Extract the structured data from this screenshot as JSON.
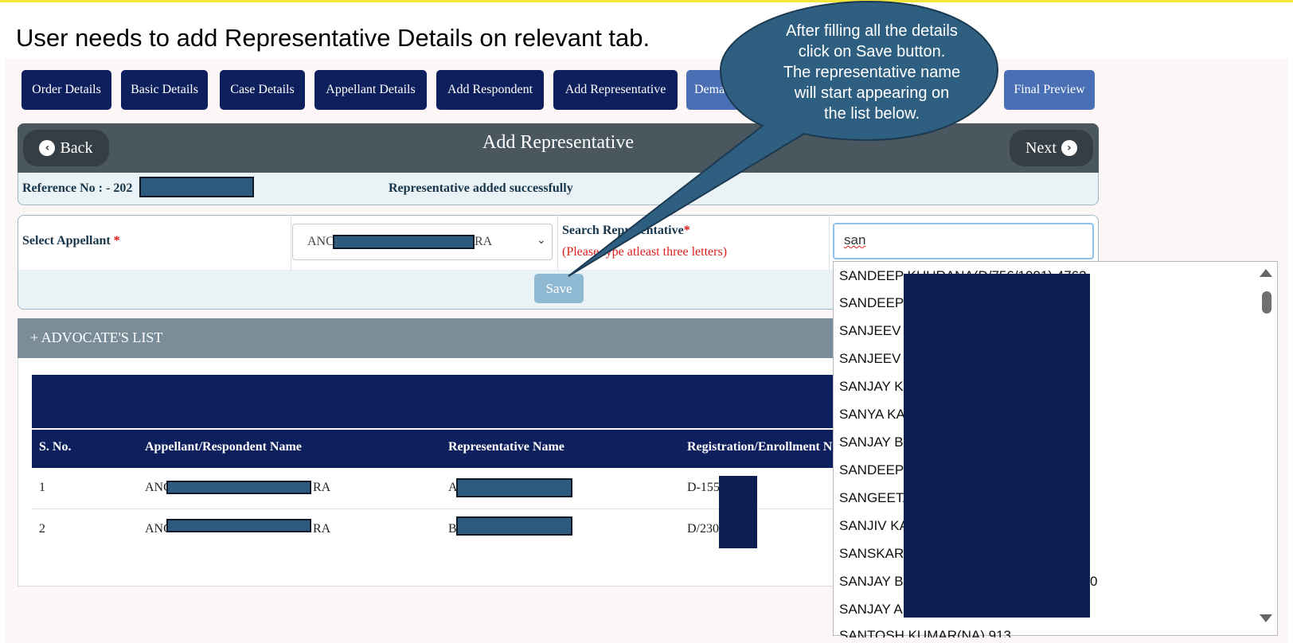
{
  "instruction": "User needs to add Representative Details on relevant tab.",
  "tabs": [
    {
      "label": "Order Details"
    },
    {
      "label": "Basic Details"
    },
    {
      "label": "Case Details"
    },
    {
      "label": "Appellant Details"
    },
    {
      "label": "Add Respondent"
    },
    {
      "label": "Add Representative"
    },
    {
      "label": "Dema"
    },
    {
      "label": "Final Preview"
    }
  ],
  "header": {
    "back_label": "Back",
    "title": "Add Representative",
    "next_label": "Next"
  },
  "reference": {
    "label": "Reference No : - 202",
    "message": "Representative added successfully"
  },
  "form": {
    "appellant_label": "Select Appellant",
    "required_mark": "*",
    "appellant_value_start": "ANC",
    "appellant_value_end": "RA",
    "search_label": "Search Representative",
    "search_hint": "(Please type atleast three letters)",
    "search_value": "san",
    "save_label": "Save"
  },
  "list": {
    "title": "+ ADVOCATE'S LIST",
    "columns": [
      "S. No.",
      "Appellant/Respondent Name",
      "Representative Name",
      "Registration/Enrollment N"
    ],
    "rows": [
      {
        "sno": "1",
        "name_start": "ANC",
        "name_end": "RA",
        "rep": "A",
        "reg": "D-155"
      },
      {
        "sno": "2",
        "name_start": "ANC",
        "name_end": "RA",
        "rep": "B",
        "reg": "D/230"
      }
    ]
  },
  "dropdown": {
    "items": [
      "SANDEEP KHURANA(D/756/1991) 4762",
      "SANDEEP",
      "SANJEEV",
      "SANJEEV",
      "SANJAY K",
      "SANYA KA",
      "SANJAY B",
      "SANDEEP",
      "SANGEETA",
      "SANJIV KA",
      "SANSKAR",
      "SANJAY B",
      "SANJAY A",
      "SANTOSH KUMAR(NA) 913"
    ],
    "trailing_text": "0"
  },
  "callout": {
    "lines": [
      "After filling all the details",
      "click on Save button.",
      "The representative name",
      "will start appearing on",
      "the list below."
    ],
    "fill": "#2f5f80"
  }
}
